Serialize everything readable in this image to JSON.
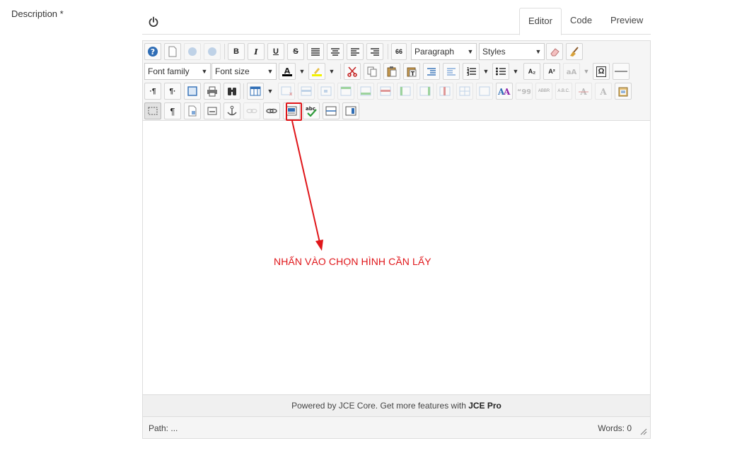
{
  "field": {
    "label": "Description *"
  },
  "tabs": [
    {
      "label": "Editor",
      "active": true
    },
    {
      "label": "Code",
      "active": false
    },
    {
      "label": "Preview",
      "active": false
    }
  ],
  "toolbar": {
    "format_select": "Paragraph",
    "styles_select": "Styles",
    "font_family_select": "Font family",
    "font_size_select": "Font size",
    "bold": "B",
    "italic": "I",
    "underline": "U",
    "strike": "S",
    "blockquote": "66",
    "subscript": "A₂",
    "superscript": "A²",
    "charmap": "Ω",
    "ltr": "·¶",
    "rtl": "¶·",
    "visualchars": "¶",
    "abbr": "ABBR",
    "acronym": "A.B.C."
  },
  "status": {
    "powered_text": "Powered by JCE Core. Get more features with ",
    "powered_link": "JCE Pro"
  },
  "footer": {
    "path": "Path: ...",
    "words": "Words: 0"
  },
  "annotation": {
    "text": "NHẤN VÀO CHỌN HÌNH CẦN LẤY"
  },
  "colors": {
    "accent": "#e0161a",
    "border": "#dddddd",
    "toolbar_bg": "#f5f5f5"
  }
}
